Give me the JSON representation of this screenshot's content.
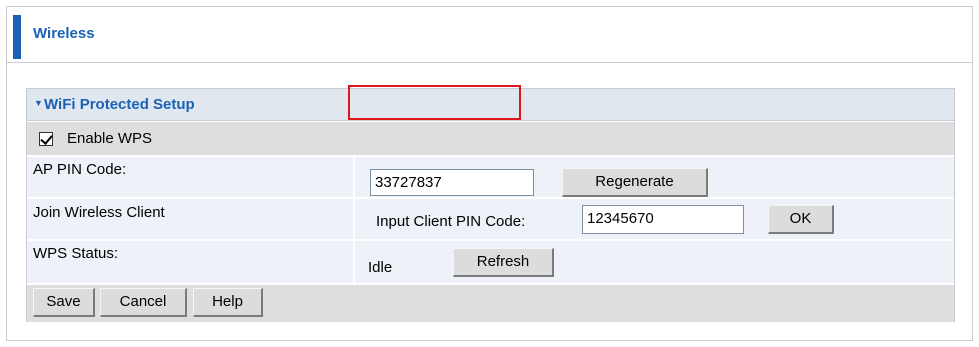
{
  "header": {
    "title": "Wireless"
  },
  "panel": {
    "title": "WiFi Protected Setup",
    "enable_wps": {
      "label": "Enable WPS",
      "checked": true
    },
    "ap_pin": {
      "label": "AP PIN Code:",
      "value": "33727837",
      "regenerate_label": "Regenerate"
    },
    "join_client": {
      "label": "Join Wireless Client",
      "input_label": "Input Client PIN Code:",
      "value": "12345670",
      "ok_label": "OK"
    },
    "wps_status": {
      "label": "WPS Status:",
      "value": "Idle",
      "refresh_label": "Refresh"
    },
    "actions": {
      "save": "Save",
      "cancel": "Cancel",
      "help": "Help"
    }
  },
  "colors": {
    "accent": "#1b62b6",
    "highlight": "#e0161d",
    "row_gray": "#dedede",
    "row_blue": "#eef2f8"
  }
}
